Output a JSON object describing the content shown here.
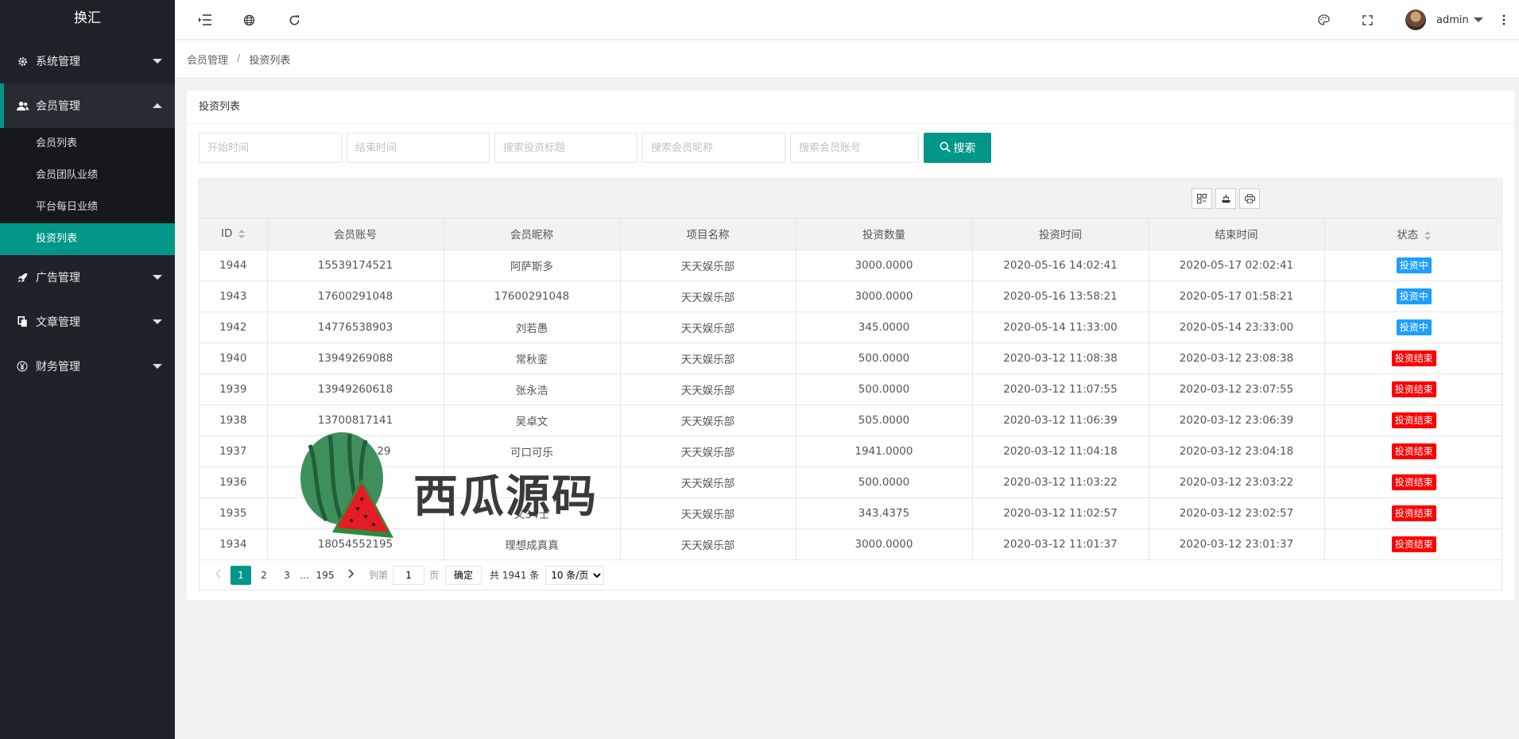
{
  "app": {
    "title": "换汇"
  },
  "sidebar": {
    "groups": [
      {
        "label": "系统管理",
        "icon": "gear-icon",
        "open": false
      },
      {
        "label": "会员管理",
        "icon": "users-icon",
        "open": true,
        "items": [
          {
            "label": "会员列表",
            "active": false
          },
          {
            "label": "会员团队业绩",
            "active": false
          },
          {
            "label": "平台每日业绩",
            "active": false
          },
          {
            "label": "投资列表",
            "active": true
          }
        ]
      },
      {
        "label": "广告管理",
        "icon": "rocket-icon",
        "open": false
      },
      {
        "label": "文章管理",
        "icon": "documents-icon",
        "open": false
      },
      {
        "label": "财务管理",
        "icon": "yen-icon",
        "open": false
      }
    ]
  },
  "header": {
    "icons": [
      "menu-fold-icon",
      "globe-icon",
      "refresh-icon",
      "theme-icon",
      "fullscreen-icon",
      "more-icon"
    ],
    "user": {
      "name": "admin"
    }
  },
  "breadcrumb": {
    "parent": "会员管理",
    "current": "投资列表",
    "separator": "/"
  },
  "card": {
    "title": "投资列表"
  },
  "filters": {
    "start_time_placeholder": "开始时间",
    "end_time_placeholder": "结束时间",
    "title_placeholder": "搜索投资标题",
    "nickname_placeholder": "搜索会员昵称",
    "account_placeholder": "搜索会员账号",
    "search_label": "搜索"
  },
  "table": {
    "columns": [
      "ID",
      "会员账号",
      "会员昵称",
      "项目名称",
      "投资数量",
      "投资时间",
      "结束时间",
      "状态"
    ],
    "rows": [
      {
        "id": "1944",
        "account": "15539174521",
        "nickname": "阿萨斯多",
        "project": "天天娱乐部",
        "amount": "3000.0000",
        "start": "2020-05-16 14:02:41",
        "end": "2020-05-17 02:02:41",
        "status": "投资中"
      },
      {
        "id": "1943",
        "account": "17600291048",
        "nickname": "17600291048",
        "project": "天天娱乐部",
        "amount": "3000.0000",
        "start": "2020-05-16 13:58:21",
        "end": "2020-05-17 01:58:21",
        "status": "投资中"
      },
      {
        "id": "1942",
        "account": "14776538903",
        "nickname": "刘若愚",
        "project": "天天娱乐部",
        "amount": "345.0000",
        "start": "2020-05-14 11:33:00",
        "end": "2020-05-14 23:33:00",
        "status": "投资中"
      },
      {
        "id": "1940",
        "account": "13949269088",
        "nickname": "常秋銮",
        "project": "天天娱乐部",
        "amount": "500.0000",
        "start": "2020-03-12 11:08:38",
        "end": "2020-03-12 23:08:38",
        "status": "投资结束"
      },
      {
        "id": "1939",
        "account": "13949260618",
        "nickname": "张永浩",
        "project": "天天娱乐部",
        "amount": "500.0000",
        "start": "2020-03-12 11:07:55",
        "end": "2020-03-12 23:07:55",
        "status": "投资结束"
      },
      {
        "id": "1938",
        "account": "13700817141",
        "nickname": "吴卓文",
        "project": "天天娱乐部",
        "amount": "505.0000",
        "start": "2020-03-12 11:06:39",
        "end": "2020-03-12 23:06:39",
        "status": "投资结束"
      },
      {
        "id": "1937",
        "account": "29",
        "nickname": "可口可乐",
        "project": "天天娱乐部",
        "amount": "1941.0000",
        "start": "2020-03-12 11:04:18",
        "end": "2020-03-12 23:04:18",
        "status": "投资结束"
      },
      {
        "id": "1936",
        "account": "",
        "nickname": "",
        "project": "天天娱乐部",
        "amount": "500.0000",
        "start": "2020-03-12 11:03:22",
        "end": "2020-03-12 23:03:22",
        "status": "投资结束"
      },
      {
        "id": "1935",
        "account": "",
        "nickname": "义34士",
        "project": "天天娱乐部",
        "amount": "343.4375",
        "start": "2020-03-12 11:02:57",
        "end": "2020-03-12 23:02:57",
        "status": "投资结束"
      },
      {
        "id": "1934",
        "account": "18054552195",
        "nickname": "理想成真真",
        "project": "天天娱乐部",
        "amount": "3000.0000",
        "start": "2020-03-12 11:01:37",
        "end": "2020-03-12 23:01:37",
        "status": "投资结束"
      }
    ],
    "status_colors": {
      "投资中": "#1e9fff",
      "投资结束": "#ff0000"
    }
  },
  "pagination": {
    "pages": [
      "1",
      "2",
      "3",
      "…",
      "195"
    ],
    "current": "1",
    "goto_label": "到第",
    "goto_value": "1",
    "page_unit": "页",
    "confirm_label": "确定",
    "total_text": "共 1941 条",
    "page_size": "10 条/页"
  },
  "watermark": {
    "text": "西瓜源码"
  },
  "colors": {
    "primary": "#009688",
    "sidebar_bg": "#20222a"
  }
}
